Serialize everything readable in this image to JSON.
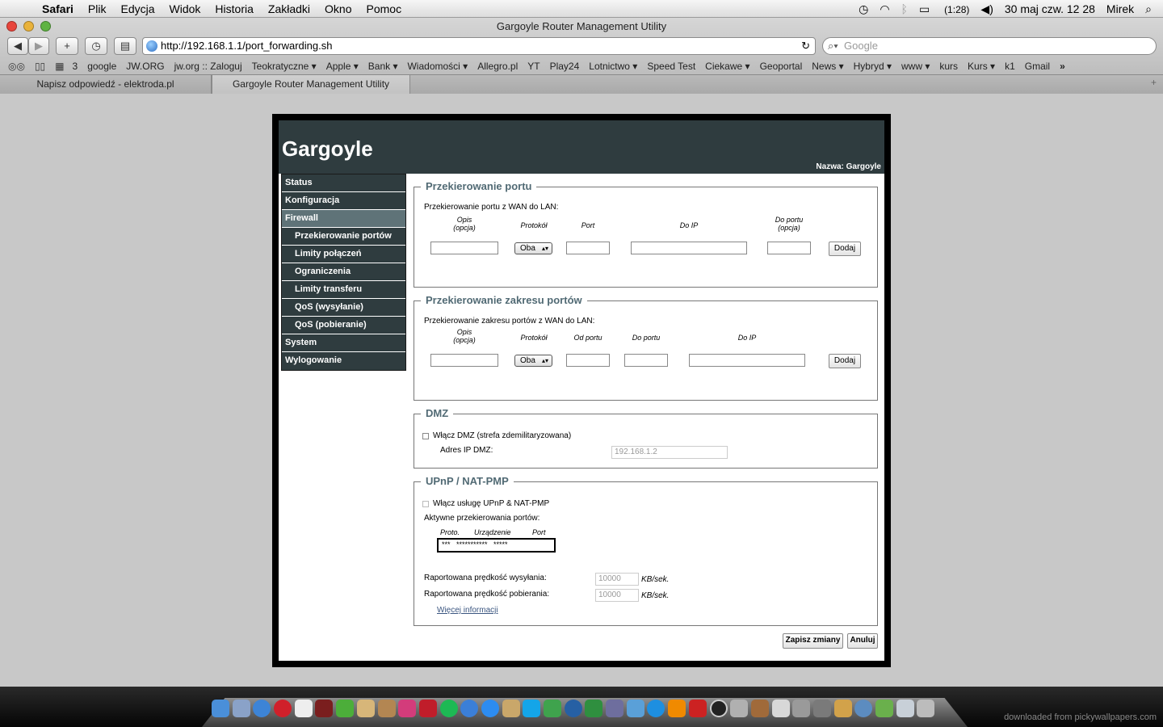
{
  "menubar": {
    "app": "Safari",
    "menus": [
      "Plik",
      "Edycja",
      "Widok",
      "Historia",
      "Zakładki",
      "Okno",
      "Pomoc"
    ],
    "battery": "(1:28)",
    "datetime": "30 maj czw.  12 28",
    "user": "Mirek"
  },
  "window": {
    "title": "Gargoyle Router Management Utility",
    "url": "http://192.168.1.1/port_forwarding.sh",
    "search_placeholder": "Google"
  },
  "bookmarks": [
    "3",
    "google",
    "JW.ORG",
    "jw.org :: Zaloguj",
    "Teokratyczne ▾",
    "Apple ▾",
    "Bank ▾",
    "Wiadomości ▾",
    "Allegro.pl",
    "YT",
    "Play24",
    "Lotnictwo ▾",
    "Speed Test",
    "Ciekawe ▾",
    "Geoportal",
    "News ▾",
    "Hybryd ▾",
    "www ▾",
    "kurs",
    "Kurs ▾",
    "k1",
    "Gmail"
  ],
  "tabs": [
    "Napisz odpowiedź - elektroda.pl",
    "Gargoyle Router Management Utility"
  ],
  "router": {
    "logo": "Gargoyle",
    "name_label": "Nazwa: Gargoyle",
    "nav": {
      "status": "Status",
      "config": "Konfiguracja",
      "firewall": "Firewall",
      "sub": [
        "Przekierowanie portów",
        "Limity połączeń",
        "Ograniczenia",
        "Limity transferu",
        "QoS (wysyłanie)",
        "QoS (pobieranie)"
      ],
      "system": "System",
      "logout": "Wylogowanie"
    },
    "pf": {
      "legend": "Przekierowanie portu",
      "desc": "Przekierowanie portu z WAN do LAN:",
      "h_opis": "Opis",
      "h_opcja": "(opcja)",
      "h_proto": "Protokół",
      "h_port": "Port",
      "h_doip": "Do IP",
      "h_doportu": "Do portu",
      "h_opcja2": "(opcja)",
      "proto_value": "Oba",
      "add": "Dodaj"
    },
    "pr": {
      "legend": "Przekierowanie zakresu portów",
      "desc": "Przekierowanie zakresu portów z WAN do LAN:",
      "h_opis": "Opis",
      "h_opcja": "(opcja)",
      "h_proto": "Protokół",
      "h_odportu": "Od portu",
      "h_doportu": "Do portu",
      "h_doip": "Do IP",
      "proto_value": "Oba",
      "add": "Dodaj"
    },
    "dmz": {
      "legend": "DMZ",
      "enable": "Włącz DMZ (strefa zdemilitaryzowana)",
      "ip_label": "Adres IP DMZ:",
      "ip_value": "192.168.1.2"
    },
    "upnp": {
      "legend": "UPnP / NAT-PMP",
      "enable": "Włącz usługę UPnP & NAT-PMP",
      "active": "Aktywne przekierowania portów:",
      "th_proto": "Proto.",
      "th_device": "Urządzenie",
      "th_port": "Port",
      "row": "***   ***********   *****",
      "up_label": "Raportowana prędkość wysyłania:",
      "up_value": "10000",
      "down_label": "Raportowana prędkość pobierania:",
      "down_value": "10000",
      "unit": "KB/sek.",
      "more": "Więcej informacji"
    },
    "save": "Zapisz zmiany",
    "cancel": "Anuluj"
  },
  "watermark": "downloaded from pickywallpapers.com"
}
